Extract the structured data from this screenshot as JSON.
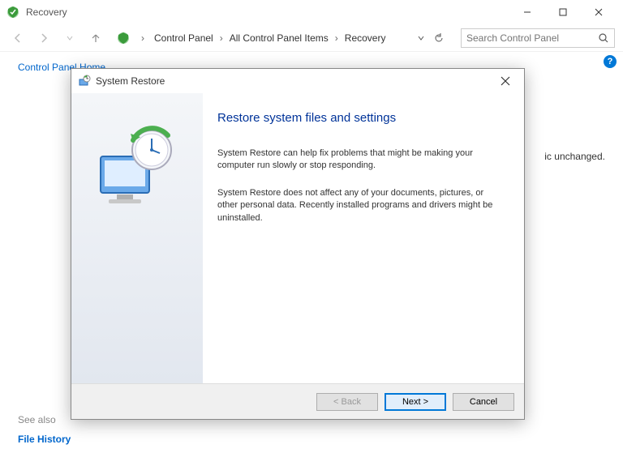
{
  "window": {
    "title": "Recovery",
    "minimize_tooltip": "Minimize",
    "maximize_tooltip": "Maximize",
    "close_tooltip": "Close"
  },
  "nav": {
    "breadcrumb": [
      "Control Panel",
      "All Control Panel Items",
      "Recovery"
    ],
    "search_placeholder": "Search Control Panel"
  },
  "left": {
    "home": "Control Panel Home",
    "see_also": "See also",
    "file_history": "File History"
  },
  "body": {
    "frag": "ic unchanged."
  },
  "dialog": {
    "title": "System Restore",
    "heading": "Restore system files and settings",
    "para1": "System Restore can help fix problems that might be making your computer run slowly or stop responding.",
    "para2": "System Restore does not affect any of your documents, pictures, or other personal data. Recently installed programs and drivers might be uninstalled.",
    "back": "< Back",
    "next": "Next >",
    "cancel": "Cancel"
  }
}
